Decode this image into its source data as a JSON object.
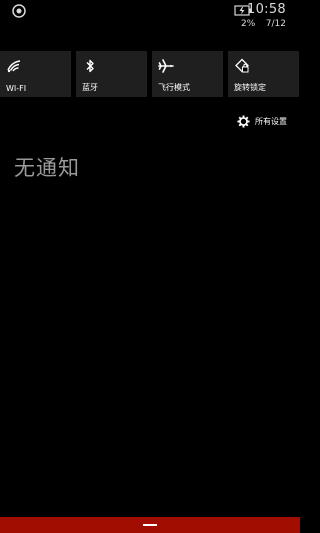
{
  "status_bar": {
    "time": "10:58",
    "battery_percent": "2%",
    "date": "7/12",
    "left_icon": "notification-app-icon",
    "battery_icon": "battery-charging-icon"
  },
  "quick_actions": [
    {
      "label": "WI-FI",
      "icon": "wifi-icon"
    },
    {
      "label": "蓝牙",
      "icon": "bluetooth-icon"
    },
    {
      "label": "飞行模式",
      "icon": "airplane-icon"
    },
    {
      "label": "旋转锁定",
      "icon": "rotation-lock-icon"
    }
  ],
  "all_settings": {
    "label": "所有设置",
    "icon": "gear-icon"
  },
  "notifications": {
    "empty_message": "无通知"
  },
  "colors": {
    "accent": "#a10d00",
    "tile_bg": "#1f1f1f",
    "background": "#000000"
  }
}
